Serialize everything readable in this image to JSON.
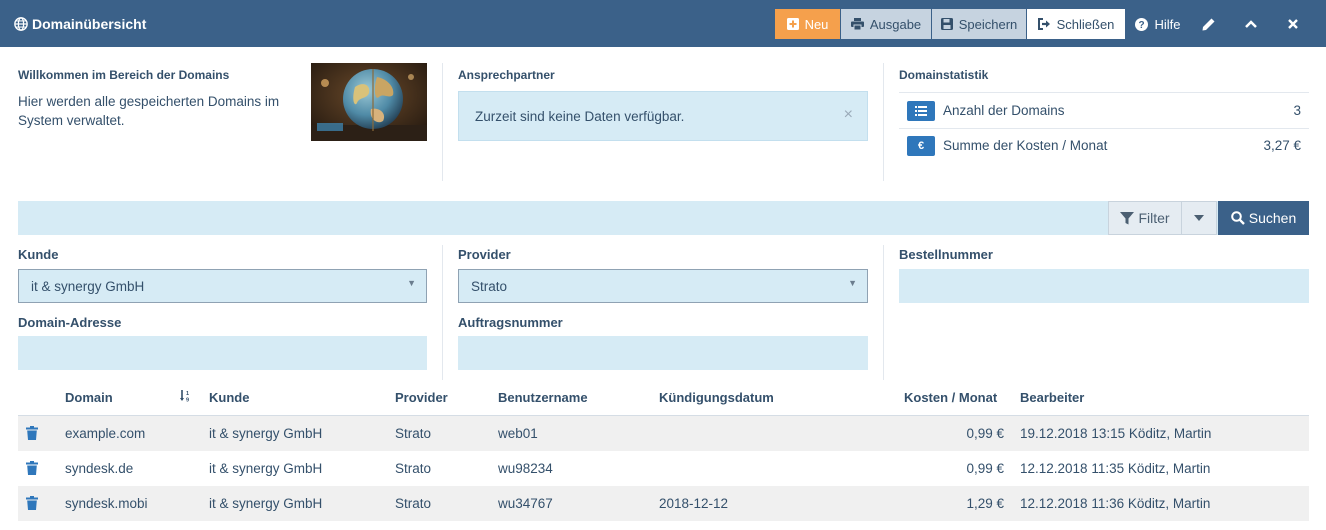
{
  "header": {
    "title": "Domainübersicht",
    "buttons": {
      "neu": "Neu",
      "ausgabe": "Ausgabe",
      "speichern": "Speichern",
      "schliessen": "Schließen",
      "hilfe": "Hilfe"
    },
    "icons": [
      "globe-icon",
      "plus-square-icon",
      "print-icon",
      "save-icon",
      "sign-out-icon",
      "help-circle-icon",
      "pencil-icon",
      "chevron-up-icon",
      "close-icon"
    ]
  },
  "welcome": {
    "heading": "Willkommen im Bereich der Domains",
    "text": "Hier werden alle gespeicherten Domains im System verwaltet."
  },
  "contact": {
    "heading": "Ansprechpartner",
    "alert": "Zurzeit sind keine Daten verfügbar.",
    "alert_close": "×"
  },
  "stats": {
    "heading": "Domainstatistik",
    "items": [
      {
        "label": "Anzahl der Domains",
        "value": "3",
        "icon": "list-icon"
      },
      {
        "label": "Summe der Kosten / Monat",
        "value": "3,27 €",
        "icon": "euro-icon"
      }
    ]
  },
  "search": {
    "filter_label": "Filter",
    "search_label": "Suchen"
  },
  "filters": {
    "kunde_label": "Kunde",
    "kunde_value": "it & synergy GmbH",
    "provider_label": "Provider",
    "provider_value": "Strato",
    "bestellnummer_label": "Bestellnummer",
    "domain_label": "Domain-Adresse",
    "auftrag_label": "Auftragsnummer"
  },
  "table": {
    "columns": [
      "Domain",
      "Kunde",
      "Provider",
      "Benutzername",
      "Kündigungsdatum",
      "Kosten / Monat",
      "Bearbeiter"
    ],
    "rows": [
      {
        "domain": "example.com",
        "kunde": "it & synergy GmbH",
        "provider": "Strato",
        "benutzer": "web01",
        "kuendigung": "",
        "kosten": "0,99 €",
        "bearbeiter": "19.12.2018 13:15 Köditz, Martin"
      },
      {
        "domain": "syndesk.de",
        "kunde": "it & synergy GmbH",
        "provider": "Strato",
        "benutzer": "wu98234",
        "kuendigung": "",
        "kosten": "0,99 €",
        "bearbeiter": "12.12.2018 11:35 Köditz, Martin"
      },
      {
        "domain": "syndesk.mobi",
        "kunde": "it & synergy GmbH",
        "provider": "Strato",
        "benutzer": "wu34767",
        "kuendigung": "2018-12-12",
        "kosten": "1,29 €",
        "bearbeiter": "12.12.2018 11:36 Köditz, Martin"
      }
    ]
  },
  "colors": {
    "header_bg": "#3b6189",
    "accent_orange": "#f5a04c",
    "field_bg": "#d6ebf5",
    "icon_blue": "#2f77bb"
  }
}
